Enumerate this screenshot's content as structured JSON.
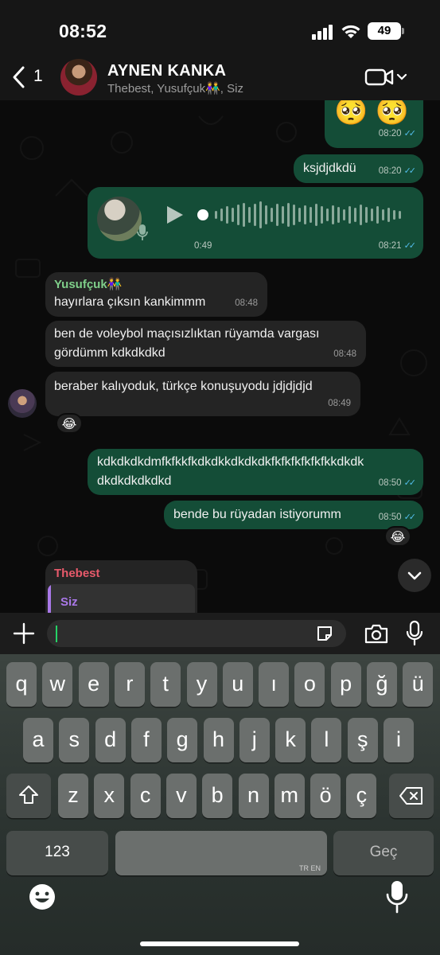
{
  "status_bar": {
    "time": "08:52",
    "battery": "49"
  },
  "header": {
    "back_count": "1",
    "title": "AYNEN KANKA",
    "subtitle": "Thebest, Yusufçuk👫, Siz"
  },
  "messages": {
    "m1": {
      "text": "🥺 🥺",
      "time": "08:20"
    },
    "m2": {
      "text": "ksjdjdkdü",
      "time": "08:20"
    },
    "voice": {
      "duration": "0:49",
      "time": "08:21"
    },
    "m3": {
      "sender": "Yusufçuk👫",
      "text": "hayırlara çıksın kankimmm",
      "time": "08:48"
    },
    "m4": {
      "text_line1": "ben de voleybol maçısızlıktan rüyamda vargası",
      "text_line2": "gördümm kdkdkdkd",
      "time": "08:48"
    },
    "m5": {
      "text": "beraber kalıyoduk, türkçe konuşuyodu jdjdjdjd",
      "time": "08:49",
      "reaction": "😂"
    },
    "m6": {
      "text_line1": "kdkdkdkdmfkfkkfkdkdkkdkdkdkfkfkfkfkfkfkkdkdk",
      "text_line2": "dkdkdkdkdkd",
      "time": "08:50"
    },
    "m7": {
      "text": "bende bu rüyadan istiyorumm",
      "time": "08:50",
      "reaction": "😂"
    },
    "m8": {
      "sender": "Thebest",
      "quoted_sender": "Siz"
    }
  },
  "input": {
    "placeholder": ""
  },
  "keyboard": {
    "row1": [
      "q",
      "w",
      "e",
      "r",
      "t",
      "y",
      "u",
      "ı",
      "o",
      "p",
      "ğ",
      "ü"
    ],
    "row2": [
      "a",
      "s",
      "d",
      "f",
      "g",
      "h",
      "j",
      "k",
      "l",
      "ş",
      "i"
    ],
    "row3": [
      "z",
      "x",
      "c",
      "v",
      "b",
      "n",
      "m",
      "ö",
      "ç"
    ],
    "numbers_label": "123",
    "space_lang": "TR EN",
    "return_label": "Geç"
  },
  "colors": {
    "outgoing_bubble": "#144d37",
    "incoming_bubble": "#242424",
    "read_ticks": "#53bdeb",
    "yusufcuk_name": "#7fcf8a",
    "thebest_name": "#e85a6b",
    "quote_bar": "#a978e8"
  },
  "icons": [
    "back-chevron-icon",
    "video-call-icon",
    "plus-icon",
    "sticker-icon",
    "camera-icon",
    "microphone-icon",
    "shift-icon",
    "backspace-icon",
    "emoji-icon",
    "dictation-icon",
    "scroll-down-icon",
    "play-icon"
  ]
}
